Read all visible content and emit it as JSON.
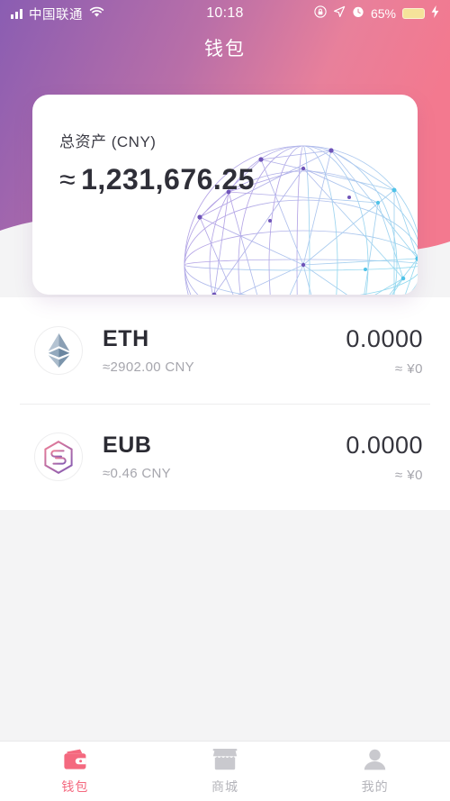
{
  "statusbar": {
    "carrier": "中国联通",
    "time": "10:18",
    "battery_percent": "65%",
    "icons": {
      "signal": "signal-bars-icon",
      "wifi": "wifi-icon",
      "rotation_lock": "rotation-lock-icon",
      "location": "location-arrow-icon",
      "alarm": "alarm-clock-icon",
      "battery": "battery-icon",
      "charging": "lightning-bolt-icon"
    }
  },
  "header": {
    "title": "钱包",
    "gradient_start": "#8a5db2",
    "gradient_end": "#f2829a"
  },
  "balance_card": {
    "label": "总资产 (CNY)",
    "approx_symbol": "≈",
    "amount": "1,231,676.25",
    "decoration": "wireframe-globe-graphic"
  },
  "assets": [
    {
      "symbol": "ETH",
      "icon": "ethereum-logo-icon",
      "rate": "≈2902.00 CNY",
      "quantity": "0.0000",
      "fiat_value": "≈ ¥0"
    },
    {
      "symbol": "EUB",
      "icon": "eub-hexagon-logo-icon",
      "rate": "≈0.46 CNY",
      "quantity": "0.0000",
      "fiat_value": "≈ ¥0"
    }
  ],
  "tabbar": {
    "active_color": "#f4697f",
    "inactive_color": "#b4b4ba",
    "items": [
      {
        "label": "钱包",
        "icon": "wallet-icon",
        "active": true
      },
      {
        "label": "商城",
        "icon": "store-icon",
        "active": false
      },
      {
        "label": "我的",
        "icon": "person-icon",
        "active": false
      }
    ]
  }
}
